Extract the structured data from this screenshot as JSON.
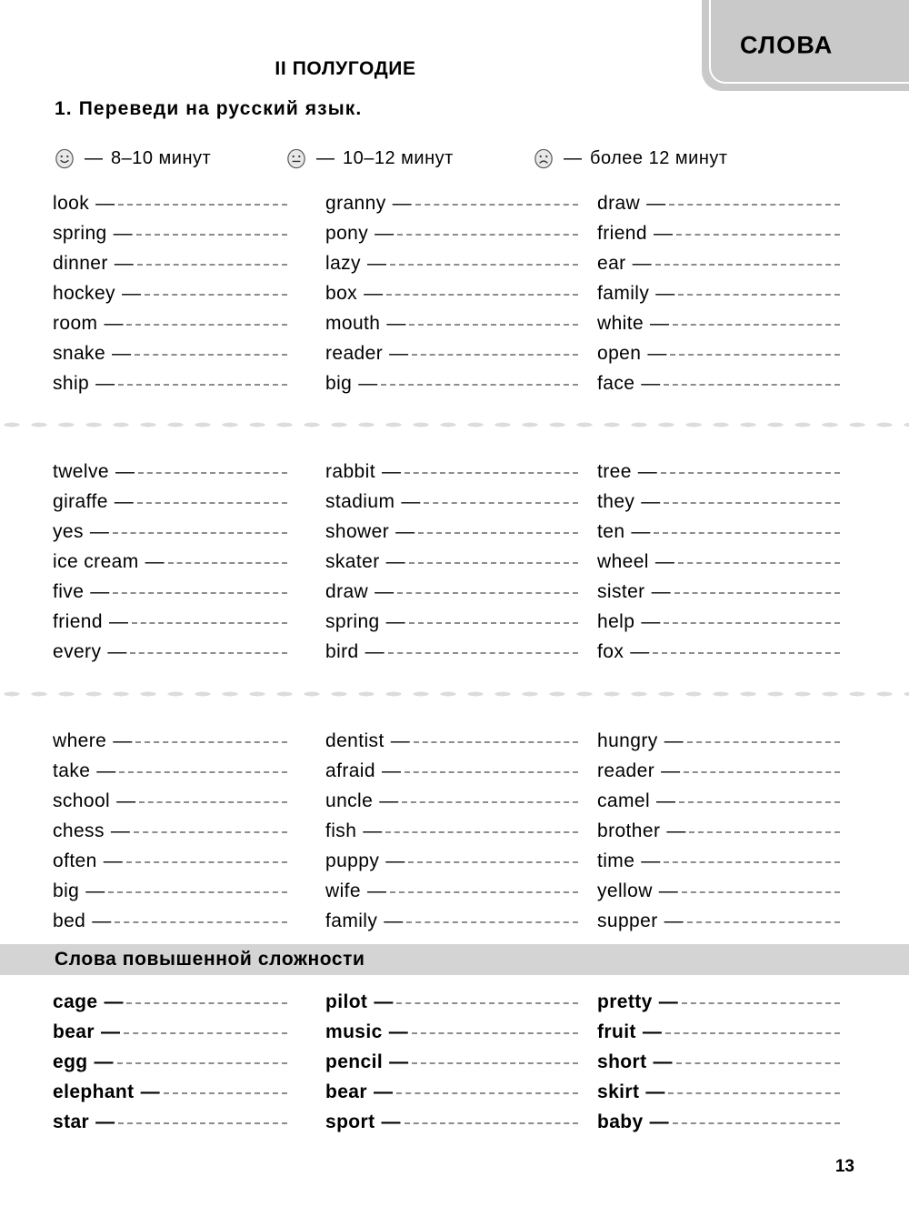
{
  "corner_tab": {
    "label": "СЛОВА"
  },
  "page_title": "II ПОЛУГОДИЕ",
  "task": {
    "number": "1.",
    "text": "Переведи на русский язык."
  },
  "legend": [
    {
      "icon": "smiley-happy-icon",
      "dash": "—",
      "text": "8–10 минут"
    },
    {
      "icon": "smiley-neutral-icon",
      "dash": "—",
      "text": "10–12 минут"
    },
    {
      "icon": "smiley-sad-icon",
      "dash": "—",
      "text": "более 12 минут"
    }
  ],
  "dash": "—",
  "blocks": [
    {
      "columns": [
        [
          "look",
          "spring",
          "dinner",
          "hockey",
          "room",
          "snake",
          "ship"
        ],
        [
          "granny",
          "pony",
          "lazy",
          "box",
          "mouth",
          "reader",
          "big"
        ],
        [
          "draw",
          "friend",
          "ear",
          "family",
          "white",
          "open",
          "face"
        ]
      ]
    },
    {
      "columns": [
        [
          "twelve",
          "giraffe",
          "yes",
          "ice cream",
          "five",
          "friend",
          "every"
        ],
        [
          "rabbit",
          "stadium",
          "shower",
          "skater",
          "draw",
          "spring",
          "bird"
        ],
        [
          "tree",
          "they",
          "ten",
          "wheel",
          "sister",
          "help",
          "fox"
        ]
      ]
    },
    {
      "columns": [
        [
          "where",
          "take",
          "school",
          "chess",
          "often",
          "big",
          "bed"
        ],
        [
          "dentist",
          "afraid",
          "uncle",
          "fish",
          "puppy",
          "wife",
          "family"
        ],
        [
          "hungry",
          "reader",
          "camel",
          "brother",
          "time",
          "yellow",
          "supper"
        ]
      ]
    }
  ],
  "advanced_section": {
    "heading": "Слова повышенной сложности",
    "columns": [
      [
        "cage",
        "bear",
        "egg",
        "elephant",
        "star"
      ],
      [
        "pilot",
        "music",
        "pencil",
        "bear",
        "sport"
      ],
      [
        "pretty",
        "fruit",
        "short",
        "skirt",
        "baby"
      ]
    ]
  },
  "page_number": "13",
  "colors": {
    "tab_background": "#c9c9c9",
    "band_background": "#d4d4d4",
    "blank_line": "#8d8d8d",
    "separator_dot": "#dcdcdc"
  }
}
